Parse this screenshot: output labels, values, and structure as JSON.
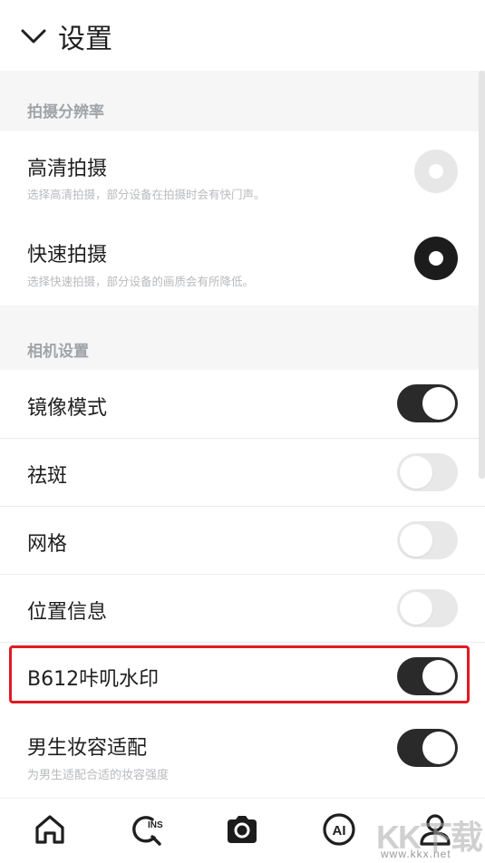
{
  "header": {
    "title": "设置"
  },
  "sections": {
    "resolution": "拍摄分辨率",
    "camera": "相机设置"
  },
  "resolution_options": [
    {
      "label": "高清拍摄",
      "desc": "选择高清拍摄，部分设备在拍摄时会有快门声。",
      "selected": false
    },
    {
      "label": "快速拍摄",
      "desc": "选择快速拍摄，部分设备的画质会有所降低。",
      "selected": true
    }
  ],
  "camera_settings": [
    {
      "label": "镜像模式",
      "on": true
    },
    {
      "label": "祛斑",
      "on": false
    },
    {
      "label": "网格",
      "on": false
    },
    {
      "label": "位置信息",
      "on": false
    },
    {
      "label": "B612咔叽水印",
      "on": true
    },
    {
      "label": "男生妆容适配",
      "desc": "为男生适配合适的妆容强度",
      "on": true
    }
  ],
  "tabbar": {
    "icons": [
      "home-icon",
      "ins-search-icon",
      "camera-icon",
      "ai-icon",
      "profile-icon"
    ],
    "ins_label": "INS",
    "ai_label": "AI"
  },
  "watermark": {
    "text": "KK下载",
    "url": "www.kkx.net"
  },
  "colors": {
    "highlight": "#e01a22",
    "toggle_on": "#2a2a2a",
    "toggle_off": "#e8e8e8",
    "section_bg": "#f6f6f6"
  }
}
